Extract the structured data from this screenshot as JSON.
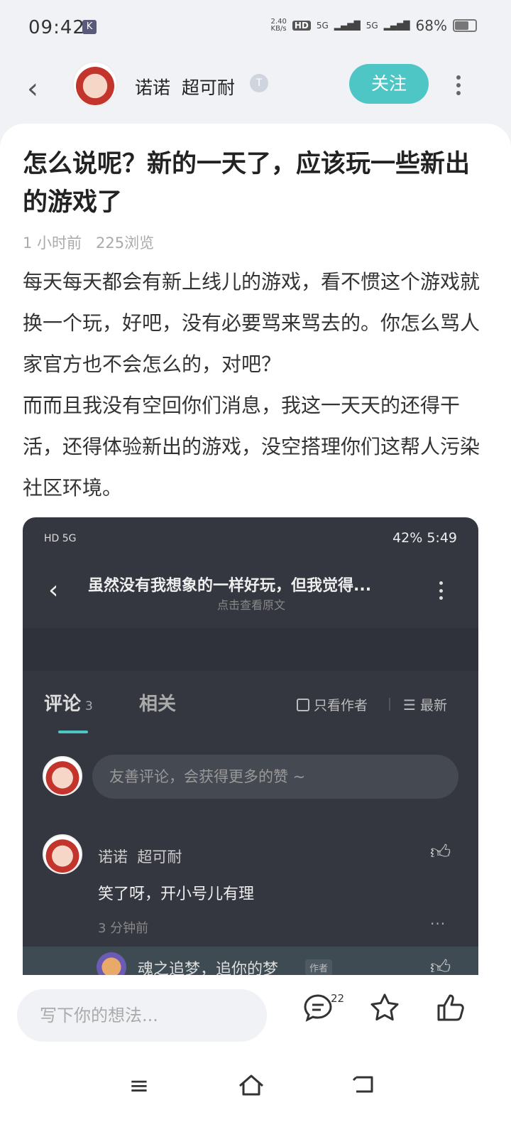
{
  "status_bar": {
    "time": "09:42",
    "net_speed": "2.40\nKB/s",
    "hd": "HD",
    "sig1": "5G",
    "sig2": "5G",
    "battery": "68%",
    "battery_level": 0.68
  },
  "header": {
    "back_icon": "chevron-left-icon",
    "username": "诺诺  超可耐",
    "badge": "T",
    "follow_label": "关注"
  },
  "post": {
    "title": "怎么说呢？新的一天了，应该玩一些新出的游戏了",
    "meta": "1 小时前   225浏览",
    "paragraph1": "每天每天都会有新上线儿的游戏，看不惯这个游戏就换一个玩，好吧，没有必要骂来骂去的。你怎么骂人家官方也不会怎么的，对吧？",
    "paragraph2": "而而且我没有空回你们消息，我这一天天的还得干活，还得体验新出的游戏，没空搭理你们这帮人污染社区环境。"
  },
  "screenshot": {
    "status_left": "HD 5G",
    "status_right": "42%  5:49",
    "title": "虽然没有我想象的一样好玩，但我觉得...",
    "subtitle": "点击查看原文",
    "tab_comments": "评论",
    "tab_comments_count": "3",
    "tab_related": "相关",
    "only_author": "只看作者",
    "sort": "最新",
    "comment_placeholder": "友善评论，会获得更多的赞 ~",
    "comment": {
      "name": "诺诺  超可耐",
      "text": "笑了呀，开小号儿有理",
      "time": "3 分钟前"
    },
    "reply": {
      "name": "魂之追梦，追你的梦",
      "tag": "作者"
    }
  },
  "bottom": {
    "input_placeholder": "写下你的想法...",
    "comment_count": "22"
  },
  "colors": {
    "accent": "#4fc6c6",
    "dark_panel": "#34373f"
  }
}
